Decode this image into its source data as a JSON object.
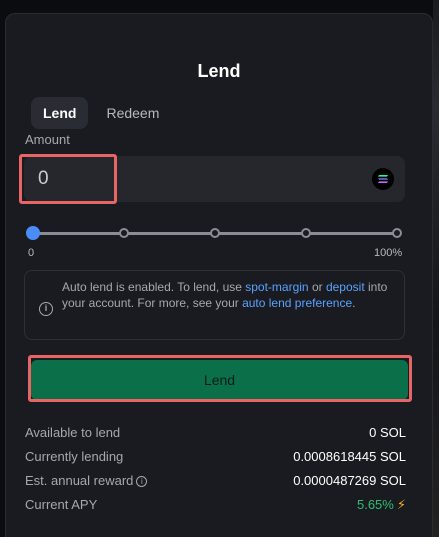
{
  "panel": {
    "title": "Lend"
  },
  "tabs": [
    {
      "label": "Lend",
      "active": true
    },
    {
      "label": "Redeem",
      "active": false
    }
  ],
  "amount": {
    "label": "Amount",
    "value": "",
    "placeholder": "0",
    "token_icon": "solana-icon"
  },
  "slider": {
    "min_label": "0",
    "max_label": "100%",
    "value_percent": 0,
    "stops": [
      0,
      25,
      50,
      75,
      100
    ]
  },
  "info": {
    "icon": "info-icon",
    "text_1": "Auto lend is enabled. To lend, use ",
    "link_1": "spot-margin",
    "text_2": " or ",
    "link_2": "deposit",
    "text_3": " into your account. For more, see your ",
    "link_3": "auto lend preference",
    "text_4": "."
  },
  "lend_button": {
    "label": "Lend"
  },
  "stats": [
    {
      "label": "Available to lend",
      "value": "0 SOL"
    },
    {
      "label": "Currently lending",
      "value": "0.0008618445 SOL"
    },
    {
      "label": "Est. annual reward",
      "value": "0.0000487269 SOL",
      "help_icon": "i"
    },
    {
      "label": "Current APY",
      "value": "5.65%",
      "value_icon": "lightning-icon"
    }
  ],
  "colors": {
    "accent_blue": "#4b8df8",
    "link": "#5aa2ff",
    "button_green": "#0b6f4a",
    "apy_green": "#2fbf6f",
    "highlight_red": "#e86565",
    "bolt_yellow": "#f2b21c"
  }
}
